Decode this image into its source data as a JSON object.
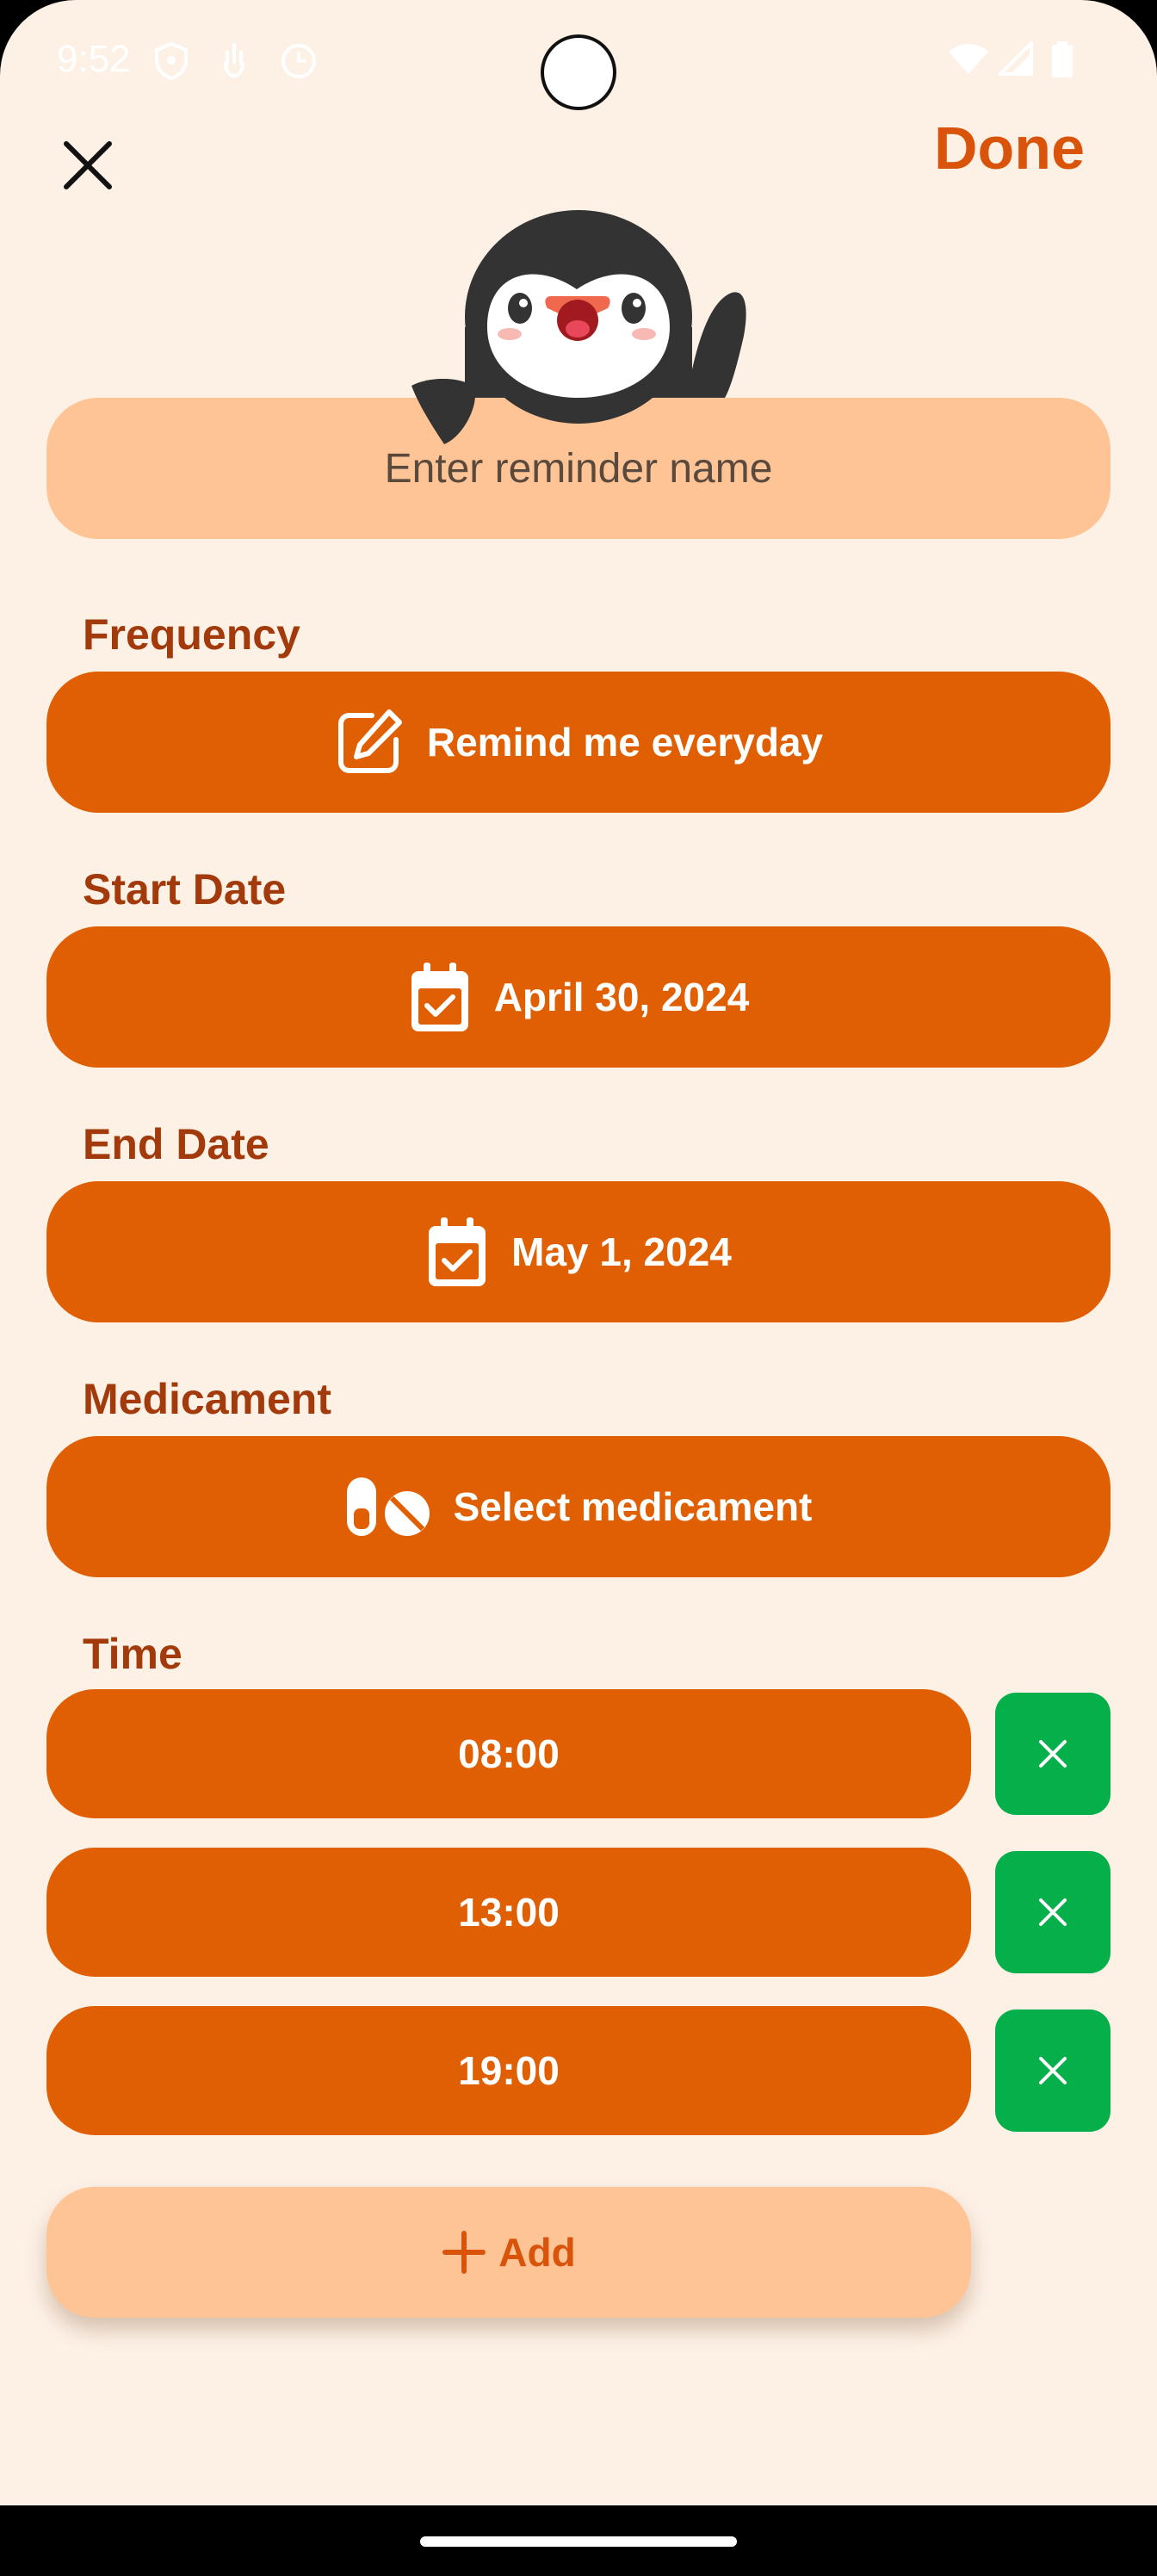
{
  "status_bar": {
    "time": "9:52",
    "icons": [
      "shield-icon",
      "hand-icon",
      "sync-icon",
      "wifi-icon",
      "signal-icon",
      "battery-icon"
    ]
  },
  "header": {
    "close_icon": "close-icon",
    "done_label": "Done"
  },
  "mascot": "penguin",
  "name_field": {
    "value": "",
    "placeholder": "Enter reminder name"
  },
  "frequency": {
    "label": "Frequency",
    "value": "Remind me everyday",
    "icon": "edit-icon"
  },
  "start_date": {
    "label": "Start Date",
    "value": "April 30, 2024",
    "icon": "calendar-check-icon"
  },
  "end_date": {
    "label": "End Date",
    "value": "May 1, 2024",
    "icon": "calendar-check-icon"
  },
  "medicament": {
    "label": "Medicament",
    "value": "Select medicament",
    "icon": "pills-icon"
  },
  "time": {
    "label": "Time",
    "entries": [
      {
        "value": "08:00"
      },
      {
        "value": "13:00"
      },
      {
        "value": "19:00"
      }
    ],
    "add_label": "Add"
  },
  "colors": {
    "background": "#FDF1E6",
    "primary": "#E05F03",
    "accent_light": "#FFC496",
    "label": "#A23A0B",
    "done": "#D9530A",
    "delete": "#05B04A"
  }
}
